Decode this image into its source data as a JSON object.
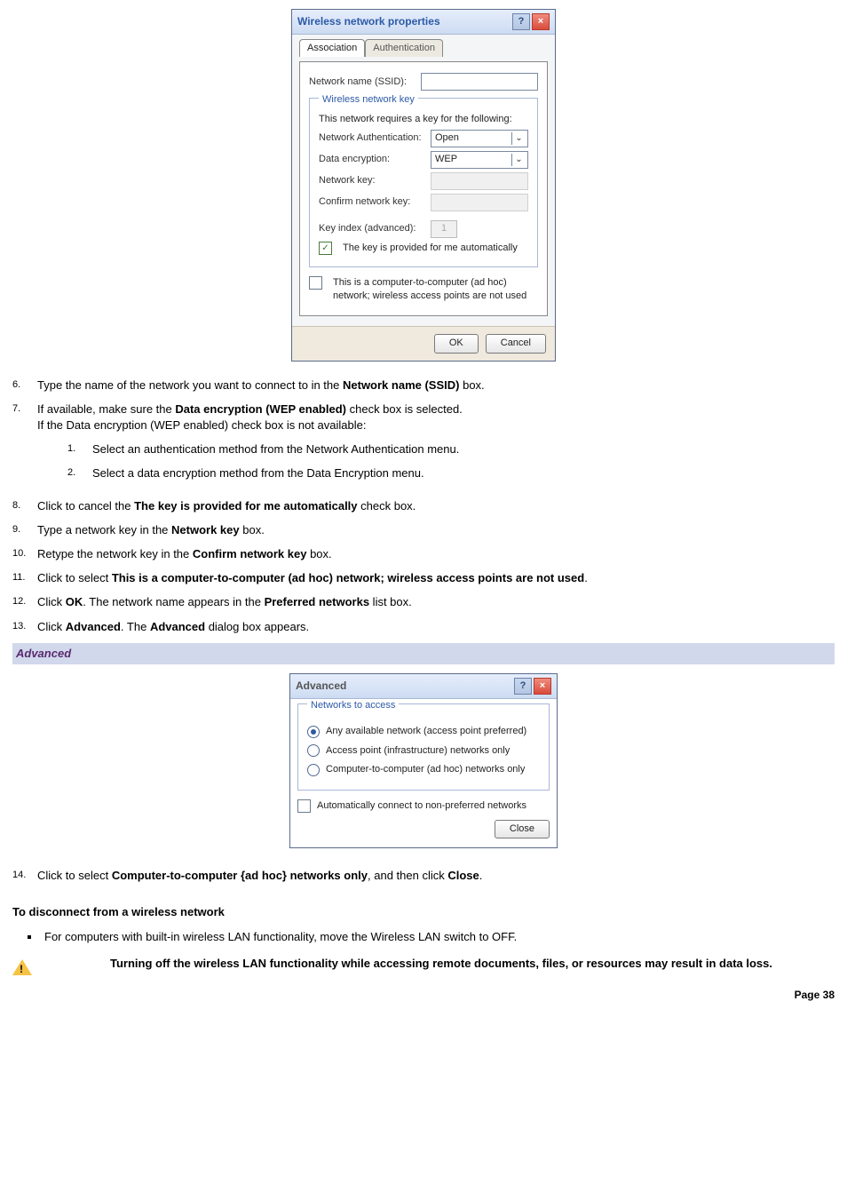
{
  "dialog1": {
    "title": "Wireless network properties",
    "help_btn": "?",
    "close_btn": "×",
    "tabs": {
      "association": "Association",
      "authentication": "Authentication"
    },
    "ssid_label": "Network name (SSID):",
    "groupbox_title": "Wireless network key",
    "groupbox_desc": "This network requires a key for the following:",
    "auth_label": "Network Authentication:",
    "auth_value": "Open",
    "enc_label": "Data encryption:",
    "enc_value": "WEP",
    "netkey_label": "Network key:",
    "confirm_label": "Confirm network key:",
    "keyindex_label": "Key index (advanced):",
    "keyindex_value": "1",
    "auto_key_label": "The key is provided for me automatically",
    "adhoc_label": "This is a computer-to-computer (ad hoc) network; wireless access points are not used",
    "ok": "OK",
    "cancel": "Cancel"
  },
  "steps_a": {
    "s6": {
      "num": "6.",
      "a": "Type the name of the network you want to connect to in the ",
      "b": "Network name (SSID)",
      "c": " box."
    },
    "s7": {
      "num": "7.",
      "a": "If available, make sure the ",
      "b": "Data encryption (WEP enabled)",
      "c": " check box is selected.",
      "line2": "If the Data encryption (WEP enabled) check box is not available:",
      "sub1": {
        "num": "1.",
        "text": "Select an authentication method from the Network Authentication menu."
      },
      "sub2": {
        "num": "2.",
        "text": "Select a data encryption method from the Data Encryption menu."
      }
    },
    "s8": {
      "num": "8.",
      "a": "Click to cancel the ",
      "b": "The key is provided for me automatically",
      "c": " check box."
    },
    "s9": {
      "num": "9.",
      "a": "Type a network key in the ",
      "b": "Network key",
      "c": " box."
    },
    "s10": {
      "num": "10.",
      "a": "Retype the network key in the ",
      "b": "Confirm network key",
      "c": " box."
    },
    "s11": {
      "num": "11.",
      "a": "Click to select ",
      "b": "This is a computer-to-computer (ad hoc) network; wireless access points are not used",
      "c": "."
    },
    "s12": {
      "num": "12.",
      "a": "Click ",
      "b": "OK",
      "c": ". The network name appears in the ",
      "d": "Preferred networks",
      "e": " list box."
    },
    "s13": {
      "num": "13.",
      "a": "Click ",
      "b": "Advanced",
      "c": ". The ",
      "d": "Advanced",
      "e": " dialog box appears."
    }
  },
  "adv_heading": "Advanced",
  "dialog2": {
    "title": "Advanced",
    "help_btn": "?",
    "close_btn": "×",
    "groupbox_title": "Networks to access",
    "opt1": "Any available network (access point preferred)",
    "opt2": "Access point (infrastructure) networks only",
    "opt3": "Computer-to-computer (ad hoc) networks only",
    "auto_label": "Automatically connect to non-preferred networks",
    "close": "Close"
  },
  "step14": {
    "num": "14.",
    "a": "Click to select ",
    "b": "Computer-to-computer {ad hoc} networks only",
    "c": ", and then click ",
    "d": "Close",
    "e": "."
  },
  "disconnect_heading": "To disconnect from a wireless network",
  "disconnect_bullet": "For computers with built-in wireless LAN functionality, move the Wireless LAN switch to OFF.",
  "warning_text": "Turning off the wireless LAN functionality while accessing remote documents, files, or resources may result in data loss.",
  "page_label": "Page 38"
}
